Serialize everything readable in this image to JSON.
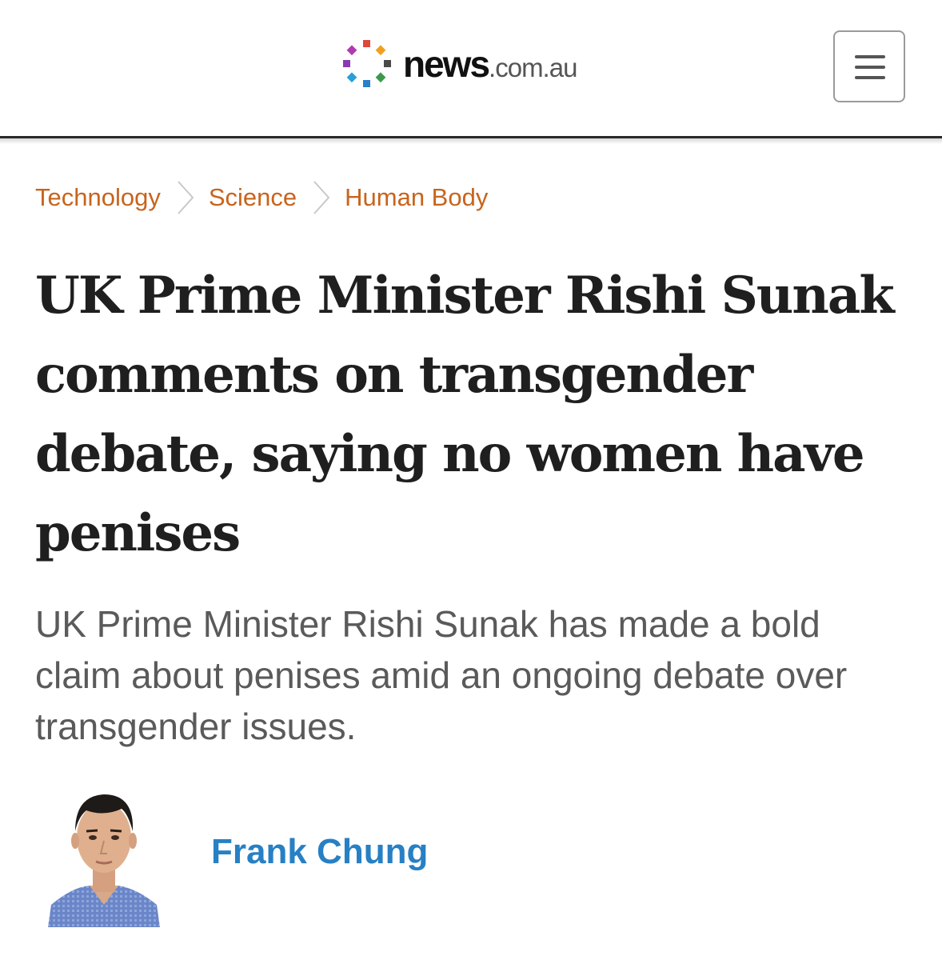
{
  "header": {
    "logo_primary": "news",
    "logo_secondary": ".com.au",
    "menu_icon": "hamburger-menu-icon",
    "logo_colors": [
      "#e0463a",
      "#f0a020",
      "#3a9a4a",
      "#2a7fc8",
      "#8a3ab0",
      "#e0463a",
      "#2a7fc8",
      "#4a4a4a"
    ]
  },
  "breadcrumb": {
    "items": [
      "Technology",
      "Science",
      "Human Body"
    ],
    "separator_icon": "chevron-right-icon",
    "color": "#c8641c"
  },
  "article": {
    "headline": "UK Prime Minister Rishi Sunak comments on transgender debate, saying no women have penises",
    "standfirst": "UK Prime Minister Rishi Sunak has made a bold claim about penises amid an ongoing debate over transgender issues.",
    "author": {
      "name": "Frank Chung",
      "name_color": "#2780c4",
      "avatar_icon": "author-avatar"
    }
  }
}
